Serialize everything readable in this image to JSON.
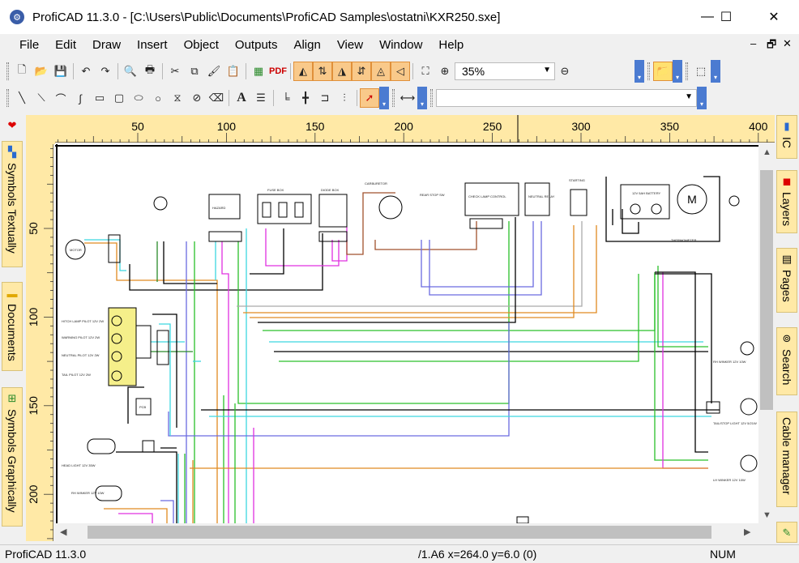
{
  "window": {
    "title": "ProfiCAD 11.3.0 - [C:\\Users\\Public\\Documents\\ProfiCAD Samples\\ostatni\\KXR250.sxe]",
    "minimize": "—",
    "maximize": "☐",
    "close": "✕"
  },
  "menu": [
    "File",
    "Edit",
    "Draw",
    "Insert",
    "Object",
    "Outputs",
    "Align",
    "View",
    "Window",
    "Help"
  ],
  "mdi": {
    "min": "–",
    "restore": "🗗",
    "close": "✕"
  },
  "toolbar1": {
    "zoom_value": "35%",
    "pdf_label": "PDF"
  },
  "left_panels": [
    {
      "label": "Symbols Textually",
      "icon": "symbols-text-icon"
    },
    {
      "label": "Documents",
      "icon": "folder-icon"
    },
    {
      "label": "Symbols Graphically",
      "icon": "symbols-graphic-icon"
    }
  ],
  "right_panels": [
    {
      "label": "IC"
    },
    {
      "label": "Layers"
    },
    {
      "label": "Pages"
    },
    {
      "label": "Search"
    },
    {
      "label": "Cable manager"
    }
  ],
  "ruler": {
    "h_ticks": [
      "50",
      "100",
      "150",
      "200",
      "250",
      "300",
      "350",
      "400"
    ],
    "v_ticks": [
      "50",
      "100",
      "150",
      "200"
    ]
  },
  "drawing_labels": {
    "motor": "MOTOR",
    "hazard": "HAZARD",
    "fuse_box": "FUSE BOX",
    "diode_box": "DIODE BOX",
    "carb": "CARBURETOR",
    "rear_stop": "REAR STOP SW",
    "check": "CHECK LAMP CONTROL",
    "neutral": "NEUTRAL RELAY",
    "starting": "STARTING",
    "battery": "12V 5AH BATTERY",
    "thermo": "THERMOMETER",
    "hitch": "HITCH LAMP PILOT 12V 2W",
    "warning": "WARNING PILOT 12V 2W",
    "neutral_pilot": "NEUTRAL PILOT 12V 2W",
    "tail": "TAIL PILOT 12V 2W",
    "pcb": "PCB",
    "rh_winker": "RH WINKER 12V 10W",
    "stop_light": "TAIL/STOP LIGHT 12V 5/21W",
    "lh_winker": "LH WINKER 12V 10W",
    "headlight": "HEAD LIGHT    12V 35W",
    "rh_front": "RH WINKER 12V 10W"
  },
  "status": {
    "app": "ProfiCAD 11.3.0",
    "coords": "/1.A6  x=264.0  y=6.0 (0)",
    "num": "NUM"
  }
}
